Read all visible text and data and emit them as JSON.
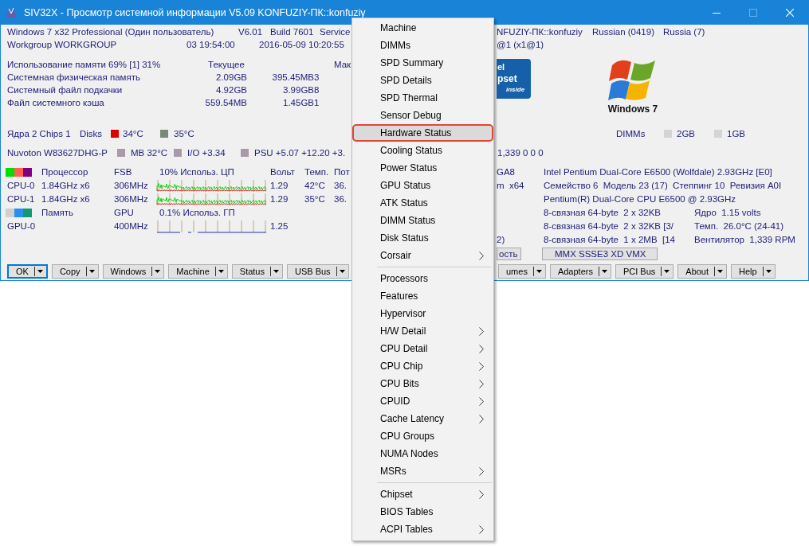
{
  "window": {
    "title": "SIV32X - Просмотр системной информации V5.09 KONFUZIY-ПК::konfuziy"
  },
  "system": {
    "left_rows": [
      [
        "Windows 7 x32 Professional (Один пользователь)",
        "V6.01",
        "Build 7601",
        "Service"
      ],
      [
        "Workgroup WORKGROUP",
        "03 19:54:00",
        "2016-05-09 10:20:55"
      ]
    ],
    "right_rows": [
      [
        "NFUZIY-ПК::konfuziy",
        "Russian (0419)",
        "Russia (7)"
      ],
      [
        "@1 (x1@1)"
      ]
    ]
  },
  "memory": {
    "columns": [
      "Использование памяти 69% [1] 31%",
      "Текущее",
      "Мак"
    ],
    "rows": [
      [
        "Системная физическая память",
        "2.09GB",
        "395.45MB",
        "3"
      ],
      [
        "Системный файл подкачки",
        "4.92GB",
        "3.99GB",
        "8"
      ],
      [
        "Файл системного кэша",
        "559.54MB",
        "1.45GB",
        "1"
      ]
    ]
  },
  "chipset_badge": {
    "texts": [
      "el",
      "pset",
      "inside"
    ]
  },
  "os_logo": {
    "caption": "Windows 7"
  },
  "cores": {
    "label": "Ядра 2 Chips 1",
    "disks_label": "Disks",
    "disks": [
      {
        "color": "#e00000",
        "reading": "34°C"
      },
      {
        "color": "#7a887a",
        "reading": "35°C"
      }
    ]
  },
  "dimms": {
    "label": "DIMMs",
    "modules": [
      "2GB",
      "1GB"
    ]
  },
  "sensors": {
    "chip": "Nuvoton W83627DHG-P",
    "readings": [
      "MB 32°C",
      "I/O +3.34",
      "PSU +5.07 +12.20 +3."
    ],
    "fans": "1,339 0 0 0"
  },
  "cpu_table": {
    "legend": [
      {
        "color": "#00e000"
      },
      {
        "color": "#ff6050"
      },
      {
        "color": "#800080"
      }
    ],
    "columns": [
      "Процессор",
      "FSB",
      "10% Использ. ЦП",
      "Вольт",
      "Темп.",
      "Пот"
    ],
    "rows": [
      {
        "name": "CPU-0",
        "clock": "1.84GHz x6",
        "fsb": "306MHz",
        "volts": "1.29",
        "temp": "42°C",
        "power": "36."
      },
      {
        "name": "CPU-1",
        "clock": "1.84GHz x6",
        "fsb": "306MHz",
        "volts": "1.29",
        "temp": "35°C",
        "power": "36."
      }
    ]
  },
  "gpu_table": {
    "legend": [
      {
        "color": "#d0d0d0"
      },
      {
        "color": "#2890f0"
      },
      {
        "color": "#109870"
      }
    ],
    "columns": [
      "Память",
      "GPU",
      "0.1% Использ. ГП"
    ],
    "rows": [
      {
        "name": "GPU-0",
        "clock": "400MHz",
        "volts": "1.25"
      }
    ]
  },
  "cpu_info": {
    "rows": [
      {
        "prefix": "GA8",
        "text": "Intel Pentium Dual-Core E6500 (Wolfdale) 2.93GHz [E0]"
      },
      {
        "prefix": "m  x64",
        "text": "Семейство 6  Модель 23 (17)  Степпинг 10  Ревизия A0I"
      },
      {
        "text": "Pentium(R) Dual-Core CPU E6500 @ 2.93GHz"
      },
      {
        "text": "8-связная 64-byte  2 x 32KB",
        "detail": "Ядро  1.15 volts"
      },
      {
        "text": "8-связная 64-byte  2 x 32KB [3/",
        "detail": "Темп.  26.0°C (24-41)"
      },
      {
        "prefix": "2)",
        "text": "8-связная 64-byte  1 x 2MB  [14",
        "detail": "Вентилятор  1,339 RPM"
      }
    ],
    "feature_buttons": [
      "ость",
      "MMX SSSE3 XD VMX"
    ]
  },
  "buttons_left": [
    {
      "label": "OK",
      "focused": true
    },
    {
      "label": "Copy",
      "focused": false
    },
    {
      "label": "Windows",
      "focused": false
    },
    {
      "label": "Machine",
      "focused": false
    },
    {
      "label": "Status",
      "focused": false
    },
    {
      "label": "USB Bus",
      "focused": false
    }
  ],
  "buttons_right": [
    {
      "label": "umes",
      "focused": false
    },
    {
      "label": "Adapters",
      "focused": false
    },
    {
      "label": "PCI Bus",
      "focused": false
    },
    {
      "label": "About",
      "focused": false
    },
    {
      "label": "Help",
      "focused": false
    }
  ],
  "menu": {
    "items": [
      {
        "kind": "item",
        "label": "Machine",
        "submenu": false,
        "selected": false
      },
      {
        "kind": "item",
        "label": "DIMMs",
        "submenu": false,
        "selected": false
      },
      {
        "kind": "item",
        "label": "SPD Summary",
        "submenu": false,
        "selected": false
      },
      {
        "kind": "item",
        "label": "SPD Details",
        "submenu": false,
        "selected": false
      },
      {
        "kind": "item",
        "label": "SPD Thermal",
        "submenu": false,
        "selected": false
      },
      {
        "kind": "item",
        "label": "Sensor Debug",
        "submenu": false,
        "selected": false
      },
      {
        "kind": "item",
        "label": "Hardware Status",
        "submenu": false,
        "selected": true
      },
      {
        "kind": "item",
        "label": "Cooling Status",
        "submenu": false,
        "selected": false
      },
      {
        "kind": "item",
        "label": "Power Status",
        "submenu": false,
        "selected": false
      },
      {
        "kind": "item",
        "label": "GPU Status",
        "submenu": false,
        "selected": false
      },
      {
        "kind": "item",
        "label": "ATK Status",
        "submenu": false,
        "selected": false
      },
      {
        "kind": "item",
        "label": "DIMM Status",
        "submenu": false,
        "selected": false
      },
      {
        "kind": "item",
        "label": "Disk Status",
        "submenu": false,
        "selected": false
      },
      {
        "kind": "item",
        "label": "Corsair",
        "submenu": true,
        "selected": false
      },
      {
        "kind": "separator"
      },
      {
        "kind": "item",
        "label": "Processors",
        "submenu": false,
        "selected": false
      },
      {
        "kind": "item",
        "label": "Features",
        "submenu": false,
        "selected": false
      },
      {
        "kind": "item",
        "label": "Hypervisor",
        "submenu": false,
        "selected": false
      },
      {
        "kind": "item",
        "label": "H/W Detail",
        "submenu": true,
        "selected": false
      },
      {
        "kind": "item",
        "label": "CPU Detail",
        "submenu": true,
        "selected": false
      },
      {
        "kind": "item",
        "label": "CPU Chip",
        "submenu": true,
        "selected": false
      },
      {
        "kind": "item",
        "label": "CPU Bits",
        "submenu": true,
        "selected": false
      },
      {
        "kind": "item",
        "label": "CPUID",
        "submenu": true,
        "selected": false
      },
      {
        "kind": "item",
        "label": "Cache Latency",
        "submenu": true,
        "selected": false
      },
      {
        "kind": "item",
        "label": "CPU Groups",
        "submenu": false,
        "selected": false
      },
      {
        "kind": "item",
        "label": "NUMA Nodes",
        "submenu": false,
        "selected": false
      },
      {
        "kind": "item",
        "label": "MSRs",
        "submenu": true,
        "selected": false
      },
      {
        "kind": "separator"
      },
      {
        "kind": "item",
        "label": "Chipset",
        "submenu": true,
        "selected": false
      },
      {
        "kind": "item",
        "label": "BIOS Tables",
        "submenu": false,
        "selected": false
      },
      {
        "kind": "item",
        "label": "ACPI Tables",
        "submenu": true,
        "selected": false
      }
    ]
  }
}
